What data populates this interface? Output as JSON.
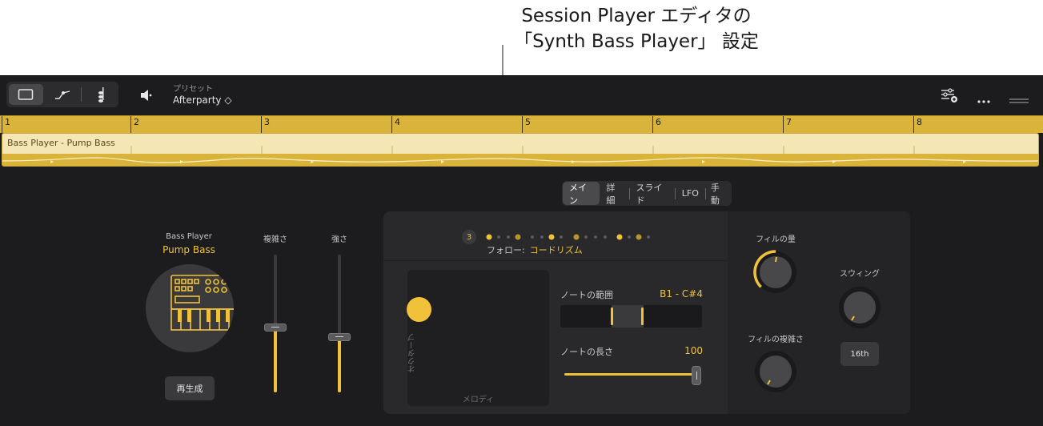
{
  "callout": {
    "line1": "Session Player エディタの",
    "line2": "「Synth Bass Player」 設定"
  },
  "toolbar": {
    "preset_label": "プリセット",
    "preset_value": "Afterparty ◇"
  },
  "ruler": {
    "bars": [
      "1",
      "2",
      "3",
      "4",
      "5",
      "6",
      "7",
      "8"
    ]
  },
  "region": {
    "title": "Bass Player - Pump Bass"
  },
  "tabs": [
    {
      "label": "メイン",
      "active": true
    },
    {
      "label": "詳細",
      "active": false
    },
    {
      "label": "スライド",
      "active": false
    },
    {
      "label": "LFO",
      "active": false
    },
    {
      "label": "手動",
      "active": false
    }
  ],
  "player": {
    "label": "Bass Player",
    "name": "Pump Bass",
    "regenerate": "再生成"
  },
  "sliders": {
    "complexity": {
      "label": "複雑さ",
      "value": 0.47
    },
    "intensity": {
      "label": "強さ",
      "value": 0.4
    }
  },
  "pattern": {
    "badge": "3",
    "follow_label": "フォロー:",
    "follow_value": "コードリズム"
  },
  "xy_pad": {
    "y_label": "オクターブ",
    "x_label": "メロディ"
  },
  "note_range": {
    "label": "ノートの範囲",
    "value": "B1 - C#4"
  },
  "note_length": {
    "label": "ノートの長さ",
    "value": "100"
  },
  "fill": {
    "amount_label": "フィルの量",
    "complexity_label": "フィルの複雑さ"
  },
  "swing": {
    "label": "スウィング",
    "value": "16th"
  },
  "colors": {
    "accent": "#f0c23a",
    "background": "#1c1c1e",
    "panel": "#29292b"
  }
}
